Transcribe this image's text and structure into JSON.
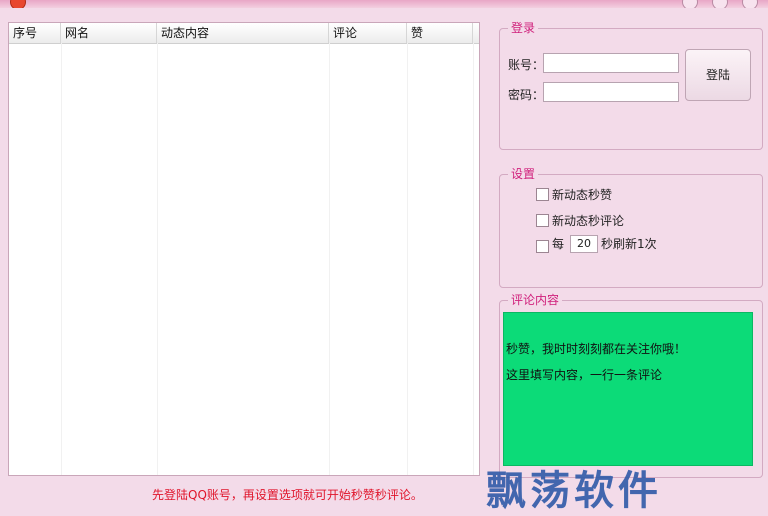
{
  "window": {
    "title": "",
    "buttons": [
      "minimize-icon",
      "maximize-icon",
      "close-icon"
    ]
  },
  "list": {
    "columns": [
      "序号",
      "网名",
      "动态内容",
      "评论",
      "赞"
    ],
    "rows": []
  },
  "login": {
    "group_title": "登录",
    "account_label": "账号：",
    "account_value": "",
    "password_label": "密码：",
    "password_value": "",
    "login_button": "登陆"
  },
  "settings": {
    "group_title": "设置",
    "option_like": "新动态秒赞",
    "option_comment": "新动态秒评论",
    "refresh_prefix": "每",
    "refresh_value": "20",
    "refresh_suffix": "秒刷新1次"
  },
  "comment": {
    "group_title": "评论内容",
    "lines": [
      "秒赞，我时时刻刻都在关注你哦！",
      "这里填写内容，一行一条评论"
    ],
    "bg_color": "#0cdb78"
  },
  "status": {
    "text": "先登陆QQ账号，再设置选项就可开始秒赞秒评论。"
  },
  "watermark": {
    "text": "飘荡软件"
  }
}
